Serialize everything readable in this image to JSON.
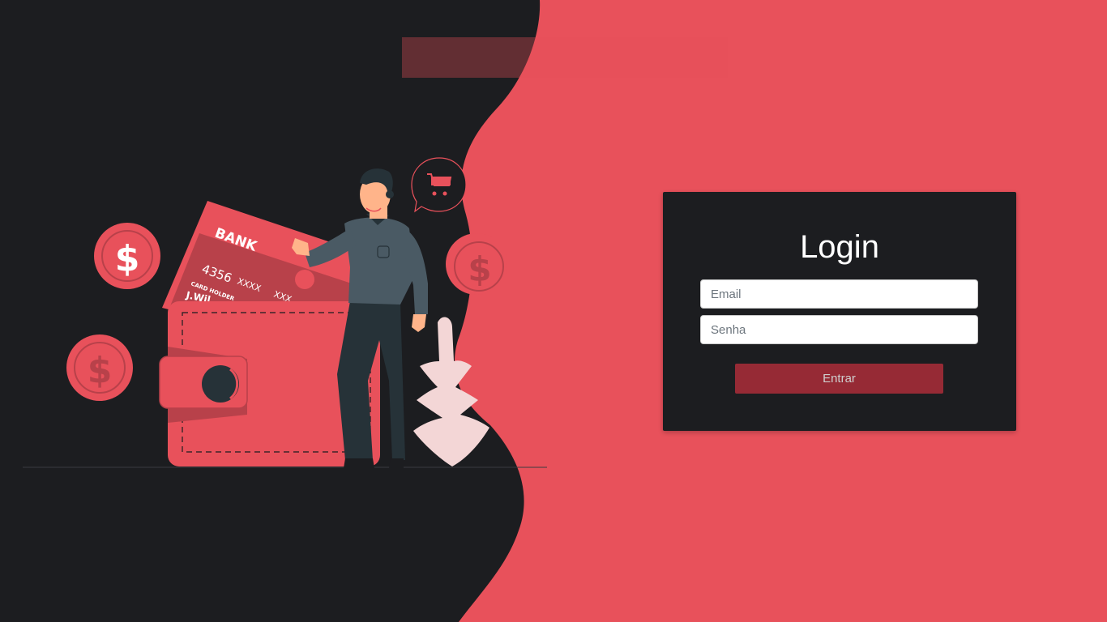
{
  "colors": {
    "background_red": "#e8515b",
    "dark_panel": "#1c1d20",
    "button": "#962a35"
  },
  "illustration": {
    "card_bank_label": "BANK",
    "card_number_group1": "4356",
    "card_number_group2": "XXXX",
    "card_number_group3": "XXX",
    "card_holder_caption": "CARD HOLDER",
    "card_holder_name": "J.Wil",
    "coin_symbol": "$",
    "icons": [
      "dollar-coin-icon",
      "shopping-cart-icon",
      "down-arrow-icon",
      "wallet-icon",
      "credit-card-icon"
    ]
  },
  "login": {
    "title": "Login",
    "email_placeholder": "Email",
    "password_placeholder": "Senha",
    "submit_label": "Entrar"
  }
}
